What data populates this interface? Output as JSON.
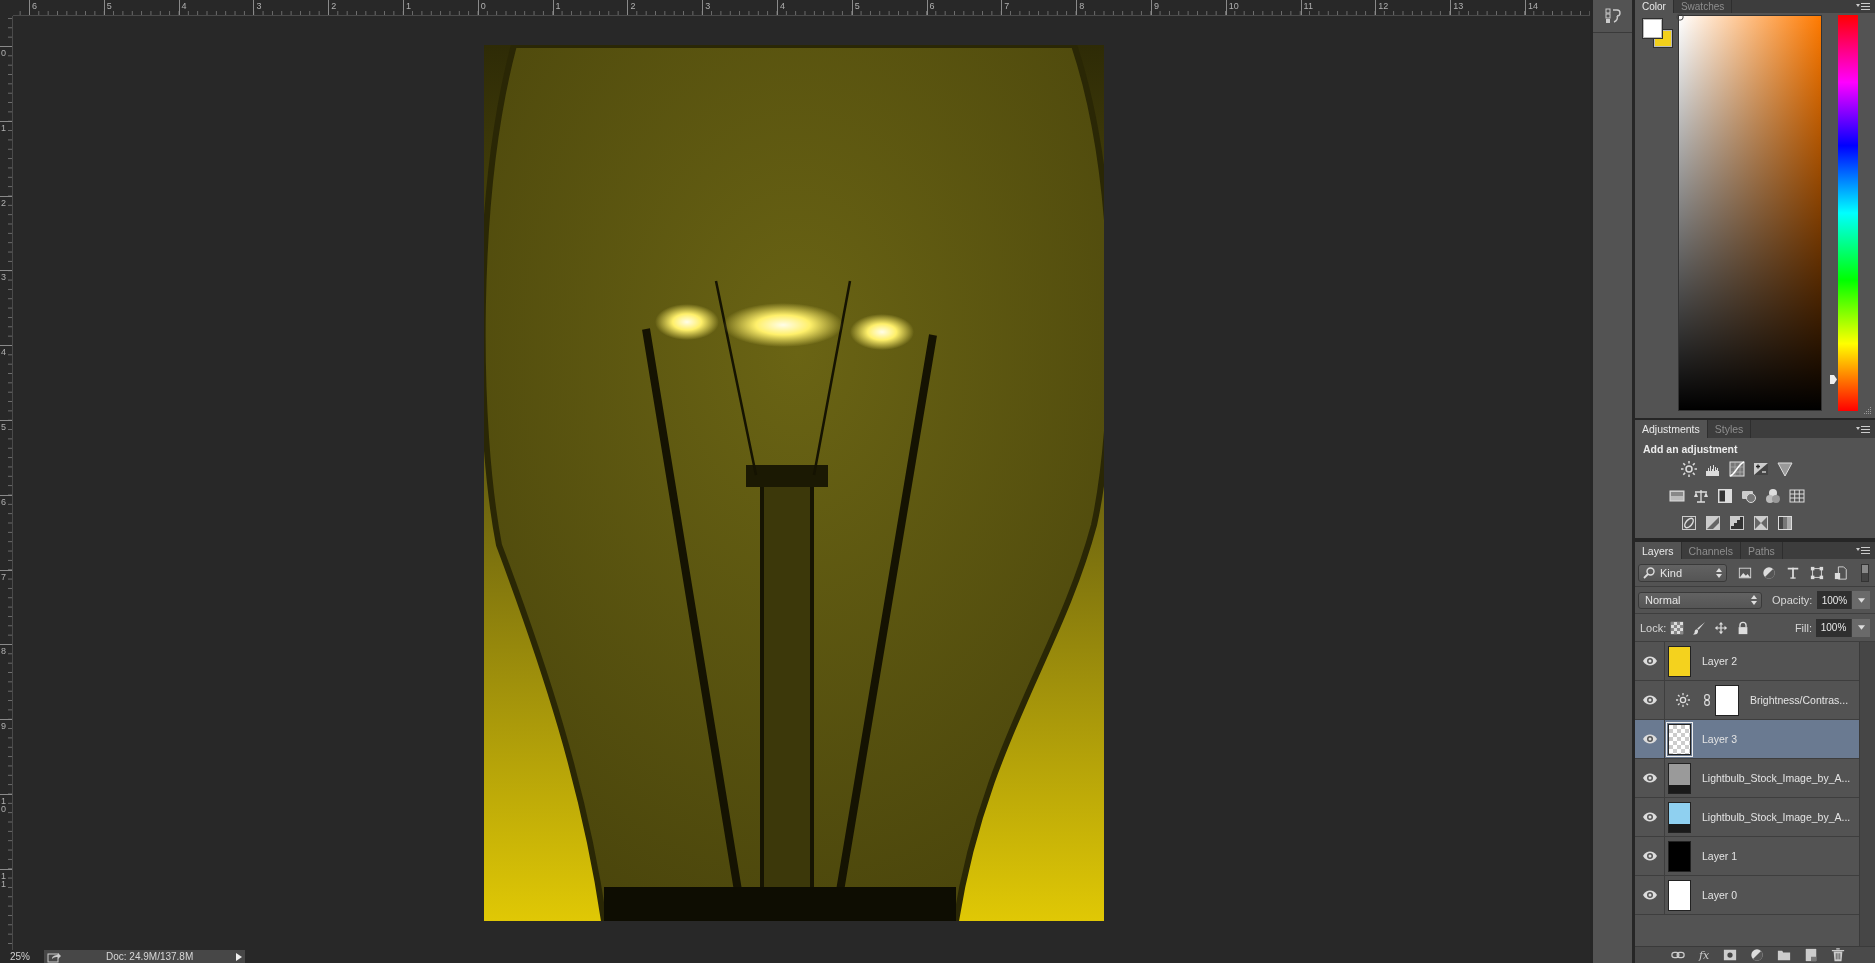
{
  "rulers": {
    "horizontal": [
      "6",
      "5",
      "4",
      "3",
      "2",
      "1",
      "0",
      "1",
      "2",
      "3",
      "4",
      "5",
      "6",
      "7",
      "8",
      "9",
      "10",
      "11",
      "12",
      "13",
      "14"
    ],
    "vertical": [
      "0",
      "1",
      "2",
      "3",
      "4",
      "5",
      "6",
      "7",
      "8",
      "9",
      "10",
      "11"
    ]
  },
  "status_bar": {
    "zoom": "25%",
    "doc_info": "Doc: 24.9M/137.8M"
  },
  "color_panel": {
    "tabs": [
      {
        "label": "Color",
        "selected": true
      },
      {
        "label": "Swatches",
        "selected": false
      }
    ],
    "swatches": [
      {
        "color": "#ffffff"
      },
      {
        "color": "#f2d01c"
      }
    ],
    "hue_slider": {
      "level": 0.08
    }
  },
  "adjustments_panel": {
    "tabs": [
      {
        "label": "Adjustments",
        "selected": true
      },
      {
        "label": "Styles",
        "selected": false
      }
    ],
    "heading": "Add an adjustment"
  },
  "layers_panel": {
    "tabs": [
      {
        "label": "Layers",
        "selected": true
      },
      {
        "label": "Channels",
        "selected": false
      },
      {
        "label": "Paths",
        "selected": false
      }
    ],
    "filter": "Kind",
    "blend_mode": "Normal",
    "opacity_label": "Opacity:",
    "opacity": "100%",
    "lock_label": "Lock:",
    "fill_label": "Fill:",
    "fill": "100%",
    "layers": [
      {
        "name": "Layer 2",
        "kind": "pixel",
        "color": "#f4d21e",
        "visible": true,
        "selected": false
      },
      {
        "name": "Brightness/Contras...",
        "kind": "adjustment",
        "color": "#ffffff",
        "visible": true,
        "selected": false
      },
      {
        "name": "Layer 3",
        "kind": "transparent",
        "visible": true,
        "selected": true
      },
      {
        "name": "Lightbulb_Stock_Image_by_A...",
        "kind": "photo",
        "color": "#9a9a9a",
        "visible": true,
        "selected": false
      },
      {
        "name": "Lightbulb_Stock_Image_by_A...",
        "kind": "photo",
        "color": "#8fd0f0",
        "visible": true,
        "selected": false
      },
      {
        "name": "Layer 1",
        "kind": "pixel",
        "color": "#000000",
        "visible": true,
        "selected": false
      },
      {
        "name": "Layer 0",
        "kind": "pixel",
        "color": "#ffffff",
        "visible": true,
        "selected": false
      }
    ],
    "fx_label": "fx"
  }
}
